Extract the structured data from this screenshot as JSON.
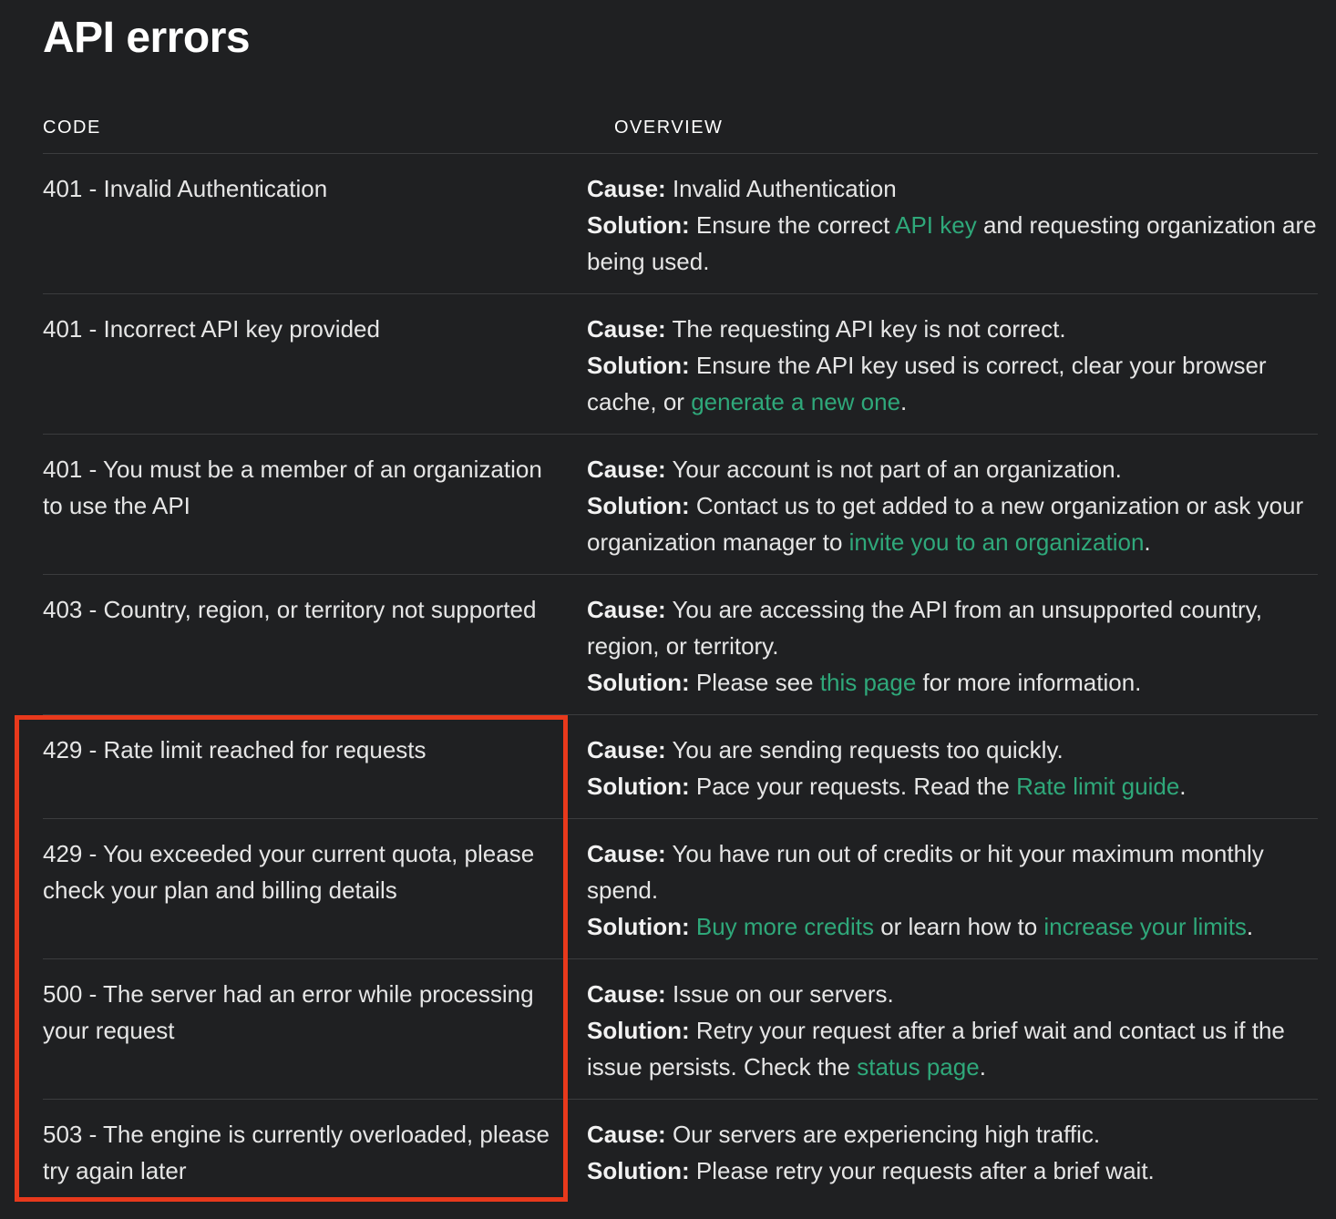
{
  "page": {
    "title": "API errors"
  },
  "table": {
    "headers": {
      "code": "CODE",
      "overview": "OVERVIEW"
    },
    "rows": [
      {
        "code": "401 - Invalid Authentication",
        "cause_label": "Cause:",
        "cause": "Invalid Authentication",
        "solution_label": "Solution:",
        "sol_a": "Ensure the correct",
        "link1": "API key",
        "sol_b": "and requesting organization are being used."
      },
      {
        "code": "401 - Incorrect API key provided",
        "cause_label": "Cause:",
        "cause": "The requesting API key is not correct.",
        "solution_label": "Solution:",
        "sol_a": "Ensure the API key used is correct, clear your browser cache, or",
        "link1": "generate a new one",
        "sol_b": "."
      },
      {
        "code": "401 - You must be a member of an organization to use the API",
        "cause_label": "Cause:",
        "cause": "Your account is not part of an organization.",
        "solution_label": "Solution:",
        "sol_a": "Contact us to get added to a new organization or ask your organization manager to",
        "link1": "invite you to an organization",
        "sol_b": "."
      },
      {
        "code": "403 - Country, region, or territory not supported",
        "cause_label": "Cause:",
        "cause": "You are accessing the API from an unsupported country, region, or territory.",
        "solution_label": "Solution:",
        "sol_a": "Please see",
        "link1": "this page",
        "sol_b": "for more information."
      },
      {
        "code": "429 - Rate limit reached for requests",
        "cause_label": "Cause:",
        "cause": "You are sending requests too quickly.",
        "solution_label": "Solution:",
        "sol_a": "Pace your requests. Read the",
        "link1": "Rate limit guide",
        "sol_b": "."
      },
      {
        "code": "429 - You exceeded your current quota, please check your plan and billing details",
        "cause_label": "Cause:",
        "cause": "You have run out of credits or hit your maximum monthly spend.",
        "solution_label": "Solution:",
        "sol_a": "",
        "link1": "Buy more credits",
        "sol_b": "or learn how to",
        "link2": "increase your limits",
        "sol_c": "."
      },
      {
        "code": "500 - The server had an error while processing your request",
        "cause_label": "Cause:",
        "cause": "Issue on our servers.",
        "solution_label": "Solution:",
        "sol_a": "Retry your request after a brief wait and contact us if the issue persists. Check the",
        "link1": "status page",
        "sol_b": "."
      },
      {
        "code": "503 - The engine is currently overloaded, please try again later",
        "cause_label": "Cause:",
        "cause": "Our servers are experiencing high traffic.",
        "solution_label": "Solution:",
        "sol_a": "Please retry your requests after a brief wait."
      }
    ]
  },
  "colors": {
    "background": "#1f2022",
    "link": "#2fa87a",
    "highlight": "#e8391c",
    "divider": "#3b3c3e"
  }
}
